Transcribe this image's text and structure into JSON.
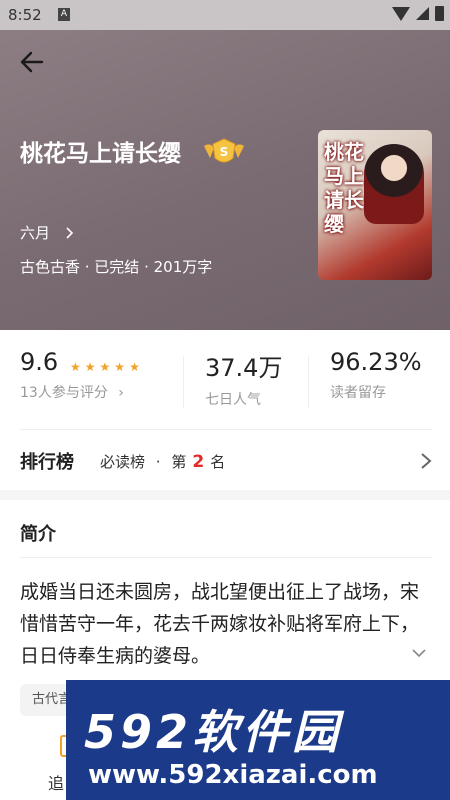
{
  "status_bar": {
    "time": "8:52",
    "a_glyph": "A"
  },
  "book": {
    "title": "桃花马上请长缨",
    "author": "六月",
    "meta": "古色古香 · 已完结 · 201万字",
    "cover_title": "桃花马上请长缨",
    "badge_letter": "S"
  },
  "stats": {
    "rating": "9.6",
    "rating_stars": 5,
    "rating_label": "13人参与评分",
    "popularity": "37.4万",
    "popularity_label": "七日人气",
    "retention": "96.23%",
    "retention_label": "读者留存"
  },
  "ranking": {
    "title": "排行榜",
    "list_name": "必读榜",
    "separator": "·",
    "prefix": "第",
    "rank": "2",
    "suffix": "名"
  },
  "intro": {
    "title": "简介",
    "text": "成婚当日还未圆房，战北望便出征上了战场，宋惜惜苦守一年，花去千两嫁妆补贴将军府上下，日日侍奉生病的婆母。"
  },
  "tags": [
    "古代言"
  ],
  "bottom": {
    "add_label": "追"
  },
  "watermark": {
    "logo_num": "592",
    "logo_cn": "软件园",
    "url": "www.592xiazai.com"
  },
  "colors": {
    "accent": "#f2a227",
    "rank_red": "#e02b2b",
    "hero_bg": "#8f8086",
    "watermark_bg": "#1b3a8a"
  }
}
